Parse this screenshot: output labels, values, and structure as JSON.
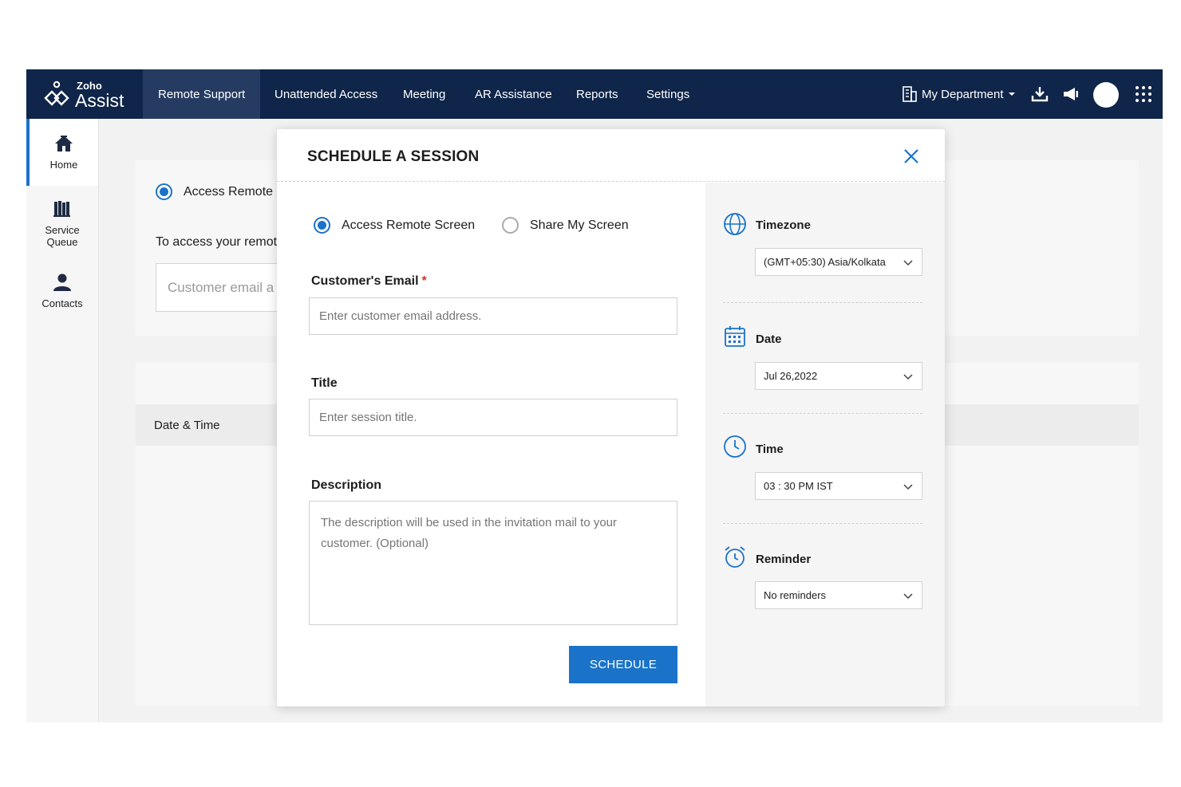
{
  "brand": {
    "small": "Zoho",
    "name": "Assist"
  },
  "nav": {
    "tabs": [
      "Remote Support",
      "Unattended Access",
      "Meeting",
      "AR Assistance",
      "Reports",
      "Settings"
    ],
    "department": "My Department"
  },
  "sidebar": {
    "items": [
      {
        "label": "Home"
      },
      {
        "label_line1": "Service",
        "label_line2": "Queue"
      },
      {
        "label": "Contacts"
      }
    ]
  },
  "background": {
    "radio_label": "Access Remote",
    "access_text": "To access your remote",
    "email_placeholder": "Customer email a",
    "table_header_datetime": "Date & Time"
  },
  "modal": {
    "title": "SCHEDULE A SESSION",
    "mode_options": [
      {
        "label": "Access Remote Screen",
        "checked": true
      },
      {
        "label": "Share My Screen",
        "checked": false
      }
    ],
    "email": {
      "label": "Customer's Email",
      "required_mark": "*",
      "placeholder": "Enter customer email address."
    },
    "title_field": {
      "label": "Title",
      "placeholder": "Enter session title."
    },
    "description": {
      "label": "Description",
      "placeholder": "The description will be used in the invitation mail to your customer. (Optional)"
    },
    "schedule_button": "SCHEDULE",
    "settings": {
      "timezone": {
        "label": "Timezone",
        "value": "(GMT+05:30) Asia/Kolkata"
      },
      "date": {
        "label": "Date",
        "value": "Jul 26,2022"
      },
      "time": {
        "label": "Time",
        "value": "03 : 30 PM IST"
      },
      "reminder": {
        "label": "Reminder",
        "value": "No reminders"
      }
    }
  },
  "colors": {
    "nav_bg": "#0f2549",
    "nav_active": "#253b62",
    "accent": "#1a73c9"
  }
}
